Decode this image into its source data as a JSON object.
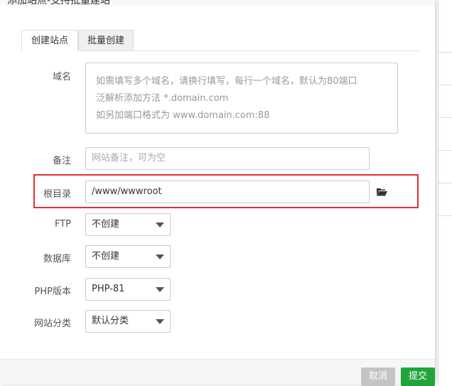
{
  "dialog": {
    "title": "添加站点-支持批量建站",
    "tabs": [
      {
        "label": "创建站点",
        "active": true
      },
      {
        "label": "批量创建",
        "active": false
      }
    ]
  },
  "form": {
    "domain": {
      "label": "域名",
      "placeholder_lines": [
        "如需填写多个域名，请换行填写，每行一个域名，默认为80端口",
        "泛解析添加方法 *.domain.com",
        "如另加端口格式为 www.domain.com:88"
      ]
    },
    "remark": {
      "label": "备注",
      "placeholder": "网站备注，可为空"
    },
    "root_dir": {
      "label": "根目录",
      "value": "/www/wwwroot",
      "icon": "folder-open-icon"
    },
    "ftp": {
      "label": "FTP",
      "selected": "不创建"
    },
    "database": {
      "label": "数据库",
      "selected": "不创建"
    },
    "php_version": {
      "label": "PHP版本",
      "selected": "PHP-81"
    },
    "category": {
      "label": "网站分类",
      "selected": "默认分类"
    }
  },
  "footer": {
    "cancel_label": "取消",
    "submit_label": "提交"
  },
  "colors": {
    "accent": "#20a53a",
    "highlight": "#e03131",
    "cancel": "#c4c4c4"
  }
}
